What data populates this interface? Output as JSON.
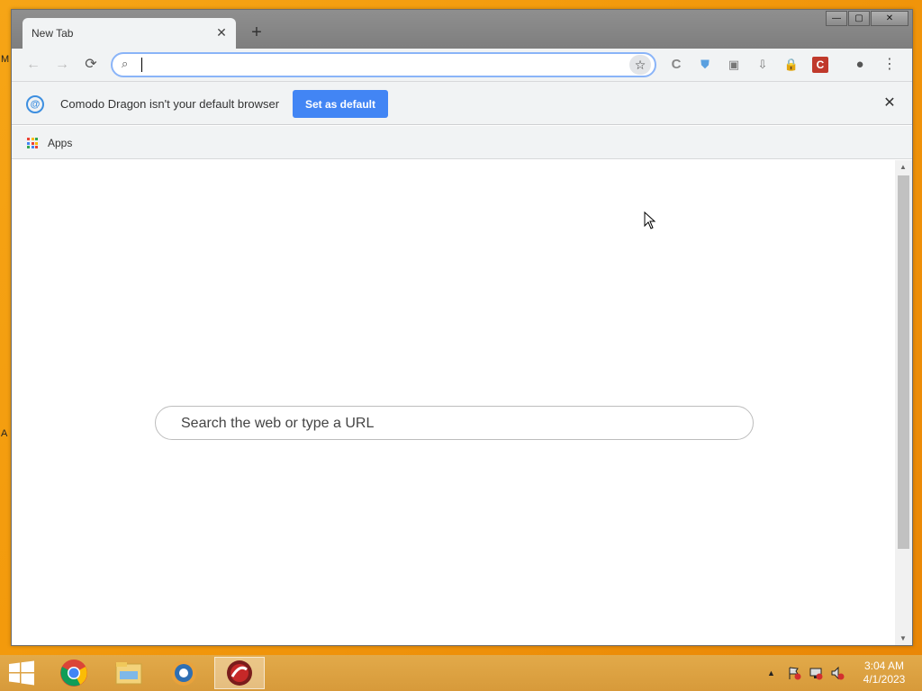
{
  "desktop": {
    "edge_glyph_1": "M",
    "edge_glyph_2": "A"
  },
  "window": {
    "tab_title": "New Tab",
    "tab_close_glyph": "✕",
    "new_tab_glyph": "+",
    "minimize_glyph": "—",
    "maximize_glyph": "▢",
    "close_glyph": "✕"
  },
  "toolbar": {
    "back_glyph": "←",
    "forward_glyph": "→",
    "reload_glyph": "⟳",
    "omnibox_value": "",
    "search_glyph": "⌕",
    "bookmark_glyph": "☆",
    "ext_c_glyph": "C",
    "ext_red_glyph": "C",
    "ext_shield_glyph": "⛊",
    "ext_puzzle_glyph": "▣",
    "ext_download_glyph": "⇩",
    "ext_lock_glyph": "🔒",
    "account_glyph": "●",
    "menu_glyph": "⋮"
  },
  "infobar": {
    "message": "Comodo Dragon isn't your default browser",
    "button_label": "Set as default",
    "close_glyph": "✕",
    "icon_glyph": "@"
  },
  "bookmarks": {
    "apps_label": "Apps"
  },
  "ntp": {
    "search_placeholder": "Search the web or type a URL"
  },
  "taskbar": {
    "time": "3:04 AM",
    "date": "4/1/2023",
    "tray_up_glyph": "▲"
  },
  "colors": {
    "accent": "#4285f4",
    "omnibox_focus": "#8ab4f8",
    "desktop": "#f39a0c",
    "taskbar": "#dca040"
  }
}
